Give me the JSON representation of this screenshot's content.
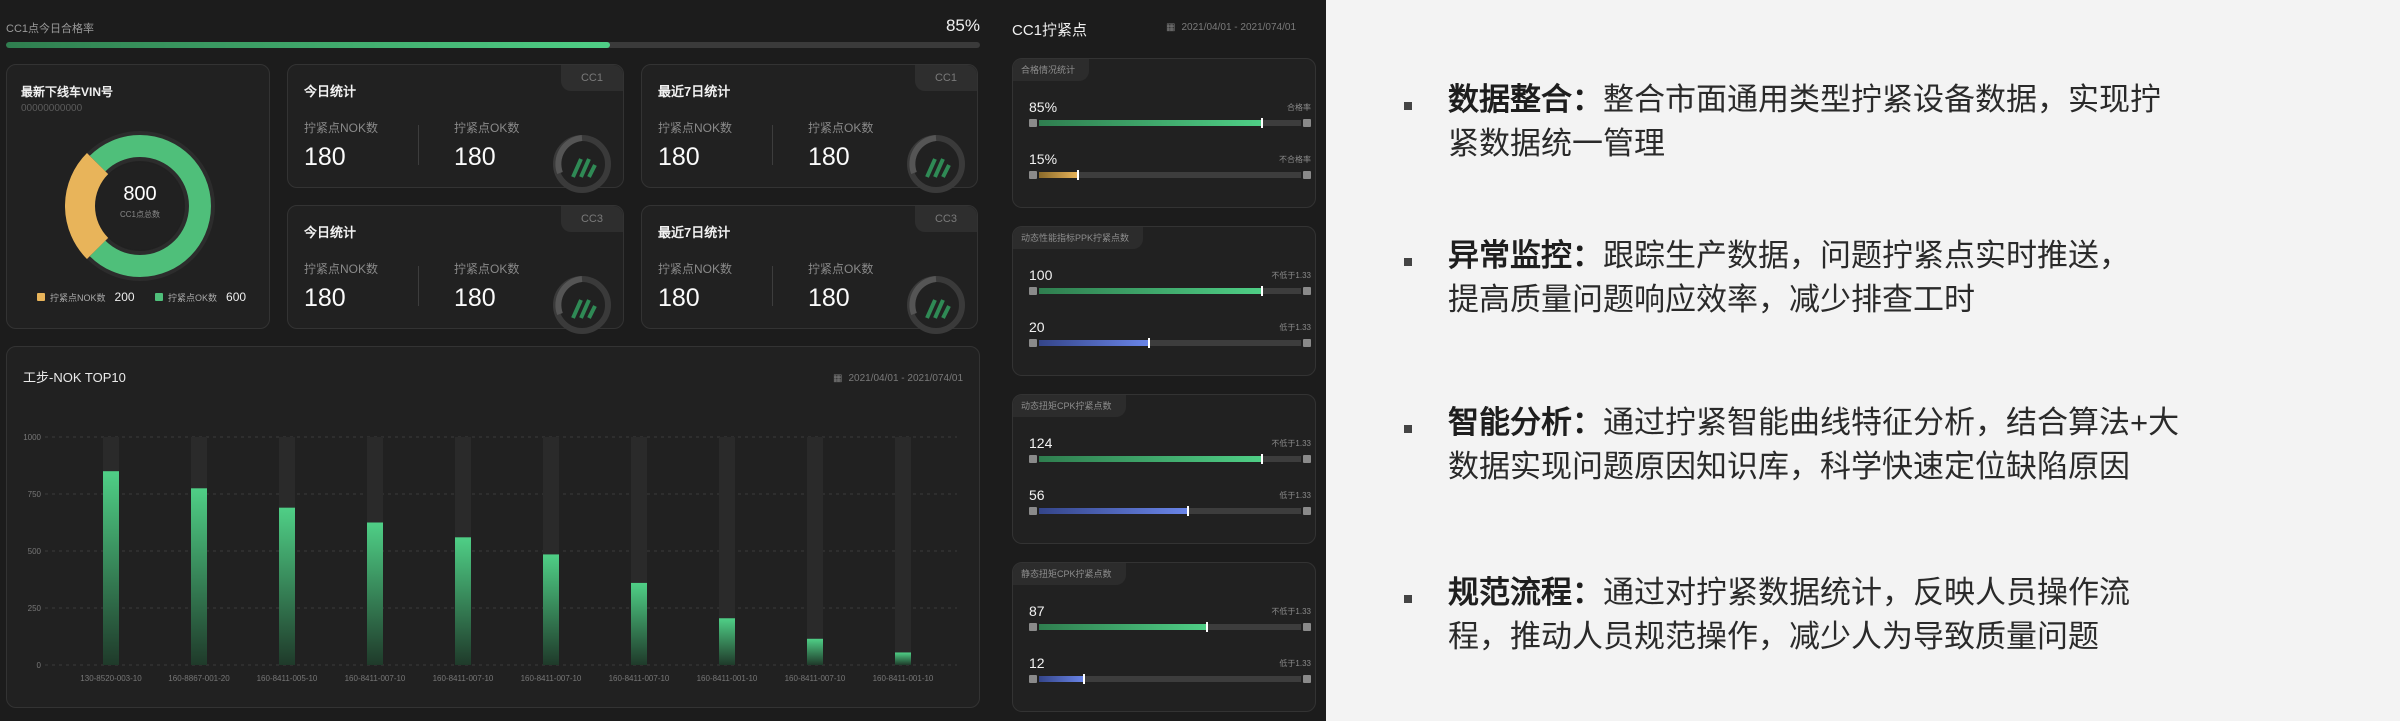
{
  "dashboard": {
    "pass_rate_label": "CC1点今日合格率",
    "pass_rate": "85%",
    "pass_rate_fraction": 0.62,
    "vin": {
      "title": "最新下线车VIN号",
      "vin_number": "00000000000",
      "center_value": "800",
      "center_label": "CC1点总数",
      "nok_label": "拧紧点NOK数",
      "nok_value": "200",
      "ok_label": "拧紧点OK数",
      "ok_value": "600",
      "nok_color": "#e8b45a",
      "ok_color": "#4fbf7a"
    },
    "stat_cards": [
      {
        "title": "今日统计",
        "tag": "CC1",
        "nok_label": "拧紧点NOK数",
        "nok_value": "180",
        "ok_label": "拧紧点OK数",
        "ok_value": "180"
      },
      {
        "title": "最近7日统计",
        "tag": "CC1",
        "nok_label": "拧紧点NOK数",
        "nok_value": "180",
        "ok_label": "拧紧点OK数",
        "ok_value": "180"
      },
      {
        "title": "今日统计",
        "tag": "CC3",
        "nok_label": "拧紧点NOK数",
        "nok_value": "180",
        "ok_label": "拧紧点OK数",
        "ok_value": "180"
      },
      {
        "title": "最近7日统计",
        "tag": "CC3",
        "nok_label": "拧紧点NOK数",
        "nok_value": "180",
        "ok_label": "拧紧点OK数",
        "ok_value": "180"
      }
    ],
    "bar_panel": {
      "title": "工步-NOK TOP10",
      "date_range": "2021/04/01 - 2021/074/01"
    },
    "right": {
      "title": "CC1拧紧点",
      "date_range": "2021/04/01 - 2021/074/01",
      "cards": [
        {
          "title": "合格情况统计",
          "rows": [
            {
              "value": "85%",
              "note": "合格率",
              "fraction": 0.85,
              "color": "green"
            },
            {
              "value": "15%",
              "note": "不合格率",
              "fraction": 0.15,
              "color": "yellow"
            }
          ]
        },
        {
          "title": "动态性能指标PPK拧紧点数",
          "rows": [
            {
              "value": "100",
              "note": "不低于1.33",
              "fraction": 0.85,
              "color": "green"
            },
            {
              "value": "20",
              "note": "低于1.33",
              "fraction": 0.42,
              "color": "blue"
            }
          ]
        },
        {
          "title": "动态扭矩CPK拧紧点数",
          "rows": [
            {
              "value": "124",
              "note": "不低于1.33",
              "fraction": 0.85,
              "color": "green"
            },
            {
              "value": "56",
              "note": "低于1.33",
              "fraction": 0.57,
              "color": "blue"
            }
          ]
        },
        {
          "title": "静态扭矩CPK拧紧点数",
          "rows": [
            {
              "value": "87",
              "note": "不低于1.33",
              "fraction": 0.64,
              "color": "green"
            },
            {
              "value": "12",
              "note": "低于1.33",
              "fraction": 0.17,
              "color": "blue"
            }
          ]
        }
      ]
    }
  },
  "chart_data": {
    "type": "bar",
    "title": "工步-NOK TOP10",
    "categories": [
      "130-8520-003-10",
      "160-8867-001-20",
      "160-8411-005-10",
      "160-8411-007-10",
      "160-8411-007-10",
      "160-8411-007-10",
      "160-8411-007-10",
      "160-8411-001-10",
      "160-8411-007-10",
      "160-8411-001-10"
    ],
    "values": [
      850,
      775,
      690,
      625,
      560,
      485,
      360,
      205,
      115,
      55
    ],
    "yticks": [
      0,
      250,
      500,
      750,
      1000
    ],
    "ylim": [
      0,
      1000
    ],
    "grid": true
  },
  "features": [
    {
      "title": "数据整合：",
      "line1": "整合市面通用类型拧紧设备数据，实现拧",
      "line2": "紧数据统一管理"
    },
    {
      "title": "异常监控：",
      "line1": "跟踪生产数据，问题拧紧点实时推送，",
      "line2": "提高质量问题响应效率，减少排查工时"
    },
    {
      "title": "智能分析：",
      "line1": "通过拧紧智能曲线特征分析，结合算法+大",
      "line2": "数据实现问题原因知识库，科学快速定位缺陷原因"
    },
    {
      "title": "规范流程：",
      "line1": "通过对拧紧数据统计，反映人员操作流",
      "line2": "程，推动人员规范操作，减少人为导致质量问题"
    }
  ]
}
